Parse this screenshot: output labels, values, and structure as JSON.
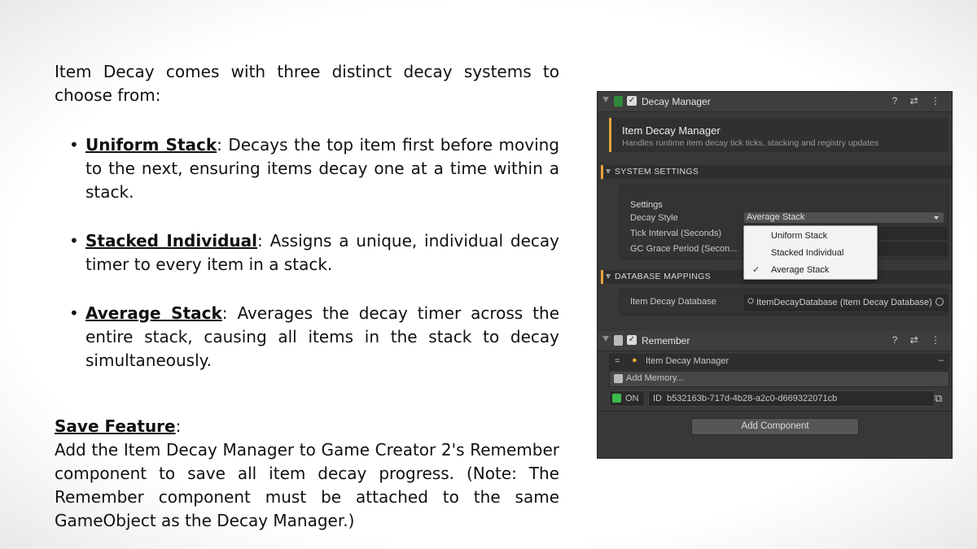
{
  "doc": {
    "intro": "Item Decay comes with three distinct decay systems to choose from:",
    "bullet_glyph": "•",
    "items": [
      {
        "term": "Uniform Stack",
        "desc": ": Decays the top item first before moving to the next, ensuring items decay one at a time within a stack."
      },
      {
        "term": "Stacked Individual",
        "desc": ": Assigns a unique, individual decay timer to every item in a stack."
      },
      {
        "term": "Average Stack",
        "desc": ": Averages the decay timer across the entire stack, causing all items in the stack to decay simultaneously."
      }
    ],
    "save_title": "Save Feature",
    "save_colon": ":",
    "save_body": "Add the Item Decay Manager to Game Creator 2's Remember component to save all item decay progress. (Note: The Remember component must be attached to the same GameObject as the Decay Manager.)"
  },
  "inspector": {
    "decay_manager": {
      "title": "Decay Manager",
      "header_icons": "? ⇄ ⋮",
      "check": "✓",
      "card_title": "Item Decay Manager",
      "card_subtitle": "Handles runtime item decay tick ticks, stacking and registry updates"
    },
    "system_settings": {
      "section_label": "SYSTEM SETTINGS",
      "group_title": "Settings",
      "decay_style_label": "Decay Style",
      "decay_style_value": "Average Stack",
      "tick_interval_label": "Tick Interval (Seconds)",
      "gc_grace_label": "GC Grace Period (Secon...",
      "options": [
        "Uniform Stack",
        "Stacked Individual",
        "Average Stack"
      ],
      "selected_mark": "✓"
    },
    "database_mappings": {
      "section_label": "DATABASE MAPPINGS",
      "db_label": "Item Decay Database",
      "db_value": "ItemDecayDatabase (Item Decay Database)",
      "db_glyph": "⛭"
    },
    "remember": {
      "title": "Remember",
      "header_icons": "? ⇄ ⋮",
      "check": "✓",
      "drag_handle": "=",
      "memory_name": "Item Decay Manager",
      "remove_glyph": "–",
      "add_memory": "Add Memory...",
      "on_label": "ON",
      "id_label": "ID",
      "id_value": "b532163b-717d-4b28-a2c0-d669322071cb",
      "copy_glyph": "⧉"
    },
    "add_component": "Add Component",
    "colors": {
      "accent": "#e8a33b",
      "panel": "#383838",
      "popup": "#f3f3f3"
    }
  }
}
